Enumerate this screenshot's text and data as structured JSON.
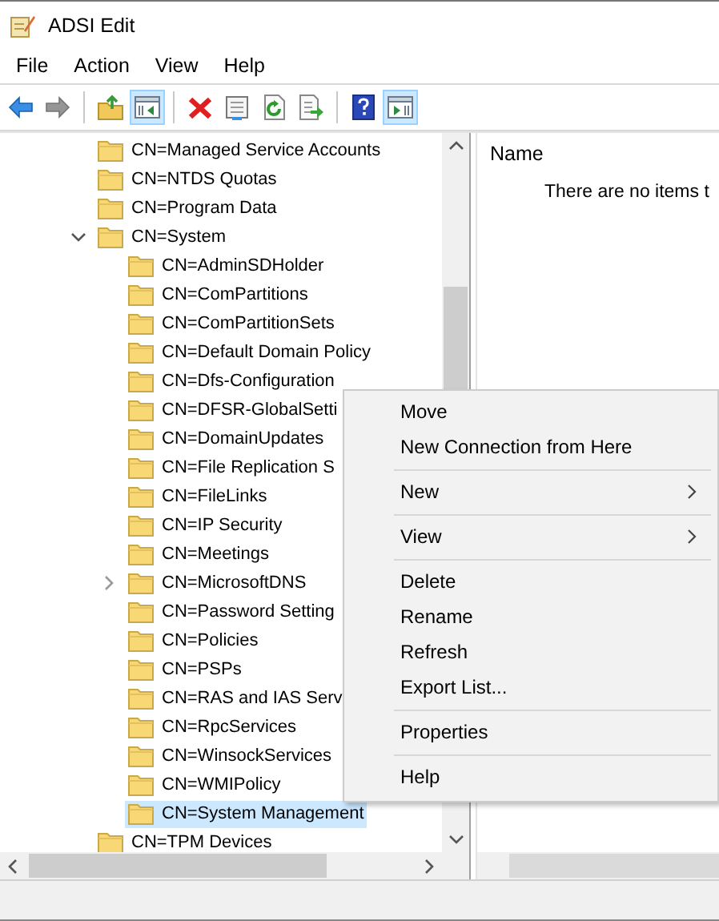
{
  "window": {
    "title": "ADSI Edit"
  },
  "menu_bar": [
    "File",
    "Action",
    "View",
    "Help"
  ],
  "toolbar": [
    [
      {
        "disabled": false,
        "pressed": false
      },
      {
        "disabled": true,
        "pressed": false
      }
    ],
    [
      {
        "disabled": false,
        "pressed": false
      },
      {
        "disabled": false,
        "pressed": true
      }
    ],
    [
      {
        "disabled": false,
        "pressed": false
      },
      {
        "disabled": false,
        "pressed": false
      },
      {
        "disabled": false,
        "pressed": false
      },
      {
        "disabled": false,
        "pressed": false
      }
    ],
    [
      {
        "disabled": false,
        "pressed": false
      },
      {
        "disabled": false,
        "pressed": true
      }
    ]
  ],
  "tree": {
    "items": [
      {
        "label": "CN=Managed Service Accounts",
        "selected": false
      },
      {
        "label": "CN=NTDS Quotas",
        "selected": false
      },
      {
        "label": "CN=Program Data",
        "selected": false
      },
      {
        "label": "CN=System",
        "selected": false,
        "expanded": true,
        "children": [
          {
            "label": "CN=AdminSDHolder",
            "selected": false
          },
          {
            "label": "CN=ComPartitions",
            "selected": false
          },
          {
            "label": "CN=ComPartitionSets",
            "selected": false
          },
          {
            "label": "CN=Default Domain Policy",
            "selected": false
          },
          {
            "label": "CN=Dfs-Configuration",
            "selected": false
          },
          {
            "label": "CN=DFSR-GlobalSetti",
            "selected": false
          },
          {
            "label": "CN=DomainUpdates",
            "selected": false
          },
          {
            "label": "CN=File Replication S",
            "selected": false
          },
          {
            "label": "CN=FileLinks",
            "selected": false
          },
          {
            "label": "CN=IP Security",
            "selected": false
          },
          {
            "label": "CN=Meetings",
            "selected": false
          },
          {
            "label": "CN=MicrosoftDNS",
            "selected": false,
            "expanded": false
          },
          {
            "label": "CN=Password Setting",
            "selected": false
          },
          {
            "label": "CN=Policies",
            "selected": false
          },
          {
            "label": "CN=PSPs",
            "selected": false
          },
          {
            "label": "CN=RAS and IAS Serv",
            "selected": false
          },
          {
            "label": "CN=RpcServices",
            "selected": false
          },
          {
            "label": "CN=WinsockServices",
            "selected": false
          },
          {
            "label": "CN=WMIPolicy",
            "selected": false
          },
          {
            "label": "CN=System Management",
            "selected": true
          }
        ]
      },
      {
        "label": "CN=TPM Devices",
        "selected": false
      }
    ]
  },
  "list_pane": {
    "columns": [
      "Name"
    ],
    "empty_message": "There are no items t"
  },
  "context_menu": {
    "groups": [
      [
        {
          "label": "Move",
          "submenu": false
        },
        {
          "label": "New Connection from Here",
          "submenu": false
        }
      ],
      [
        {
          "label": "New",
          "submenu": true
        }
      ],
      [
        {
          "label": "View",
          "submenu": true
        }
      ],
      [
        {
          "label": "Delete",
          "submenu": false
        },
        {
          "label": "Rename",
          "submenu": false
        },
        {
          "label": "Refresh",
          "submenu": false
        },
        {
          "label": "Export List...",
          "submenu": false
        }
      ],
      [
        {
          "label": "Properties",
          "submenu": false
        }
      ],
      [
        {
          "label": "Help",
          "submenu": false
        }
      ]
    ]
  }
}
